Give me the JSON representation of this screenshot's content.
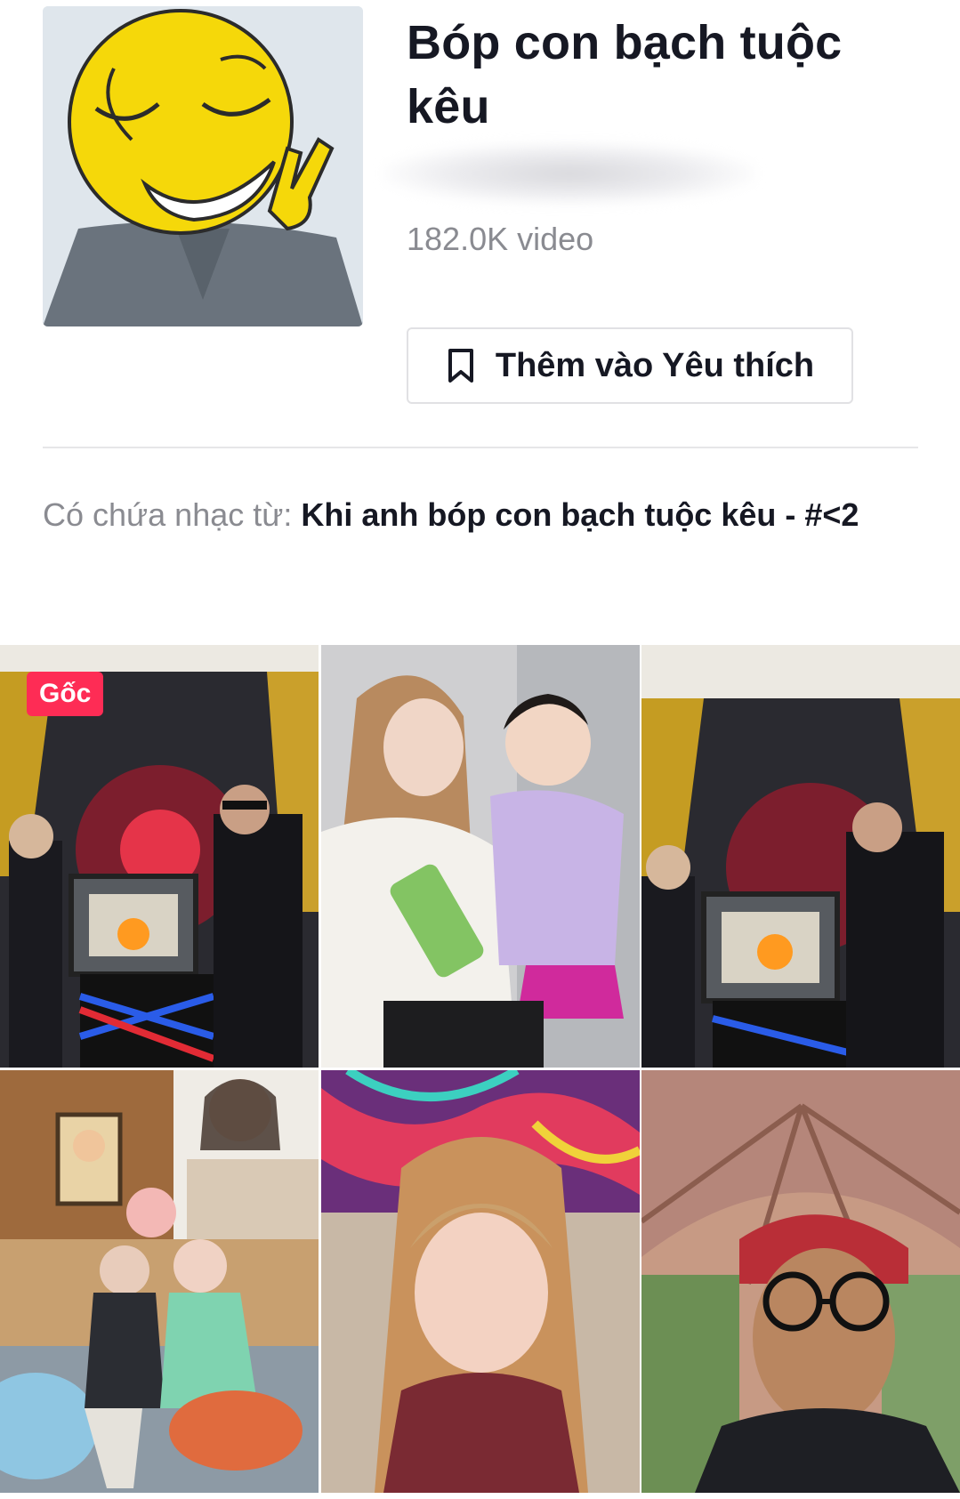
{
  "header": {
    "title": "Bóp con bạch tuộc kêu",
    "video_count": "182.0K video",
    "favorite_button_label": "Thêm vào Yêu thích",
    "favorite_icon": "bookmark-icon"
  },
  "music": {
    "prefix": "Có chứa nhạc từ: ",
    "name": "Khi anh bóp con bạch tuộc kêu - #<2"
  },
  "videos": [
    {
      "badge": "Gốc"
    },
    {
      "badge": ""
    },
    {
      "badge": ""
    },
    {
      "badge": ""
    },
    {
      "badge": ""
    },
    {
      "badge": ""
    }
  ],
  "colors": {
    "accent": "#fe2c55",
    "text_primary": "#161823",
    "text_secondary": "#8a8b91",
    "divider": "#e6e6e8"
  }
}
